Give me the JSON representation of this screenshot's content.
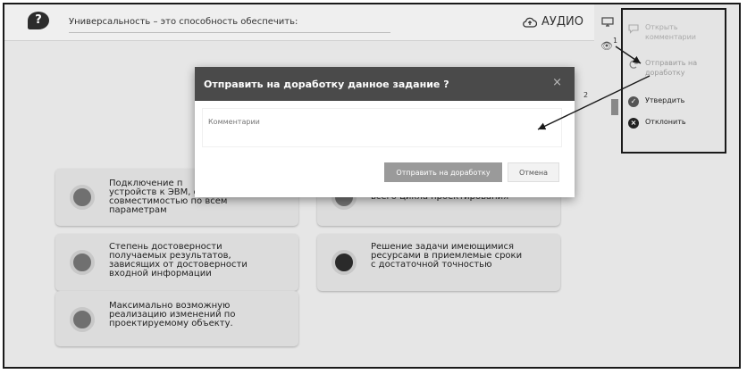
{
  "question": "Универсальность – это способность обеспечить:",
  "audio_label": "АУДИО",
  "callouts": [
    "1",
    "2"
  ],
  "side_panel": {
    "items": [
      {
        "label": "Открыть\nкомментарии",
        "icon": "speech-bubble-icon"
      },
      {
        "label": "Отправить на\nдоработку",
        "icon": "refresh-icon"
      },
      {
        "label": "Утвердить",
        "icon": "check-circle-icon"
      },
      {
        "label": "Отклонить",
        "icon": "x-circle-icon"
      }
    ]
  },
  "modal": {
    "title": "Отправить на доработку данное задание ?",
    "close": "×",
    "textarea_placeholder": "Комментарии",
    "send_label": "Отправить на доработку",
    "cancel_label": "Отмена"
  },
  "answers": [
    "Подключение п\nустройств к ЭВМ, обладающих\nсовместимостью по всем\nпараметрам",
    "всего цикла проектирования",
    "Степень достоверности\nполучаемых результатов,\nзависящих от достоверности\nвходной информации",
    "Решение задачи имеющимися\nресурсами в приемлемые сроки\nс достаточной точностью",
    "Максимально возможную\nреализацию изменений по\nпроектируемому объекту."
  ]
}
